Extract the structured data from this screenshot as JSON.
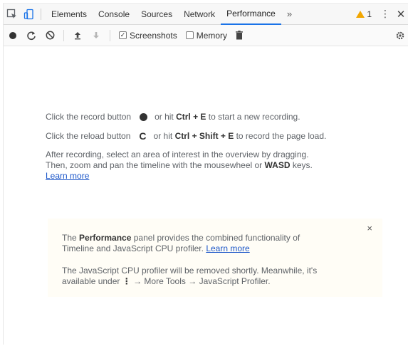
{
  "tabbar": {
    "tabs": [
      "Elements",
      "Console",
      "Sources",
      "Network",
      "Performance"
    ],
    "active_tab": "Performance",
    "more_label": "»",
    "warning_count": "1",
    "kebab_label": "⋮",
    "close_label": "✕"
  },
  "toolbar": {
    "screenshots_label": "Screenshots",
    "screenshots_checked": true,
    "memory_label": "Memory",
    "memory_checked": false
  },
  "landing": {
    "record_prefix": "Click the record button",
    "record_mid": "or hit",
    "record_keys": "Ctrl + E",
    "record_suffix": "to start a new recording.",
    "reload_prefix": "Click the reload button",
    "reload_mid": "or hit",
    "reload_keys": "Ctrl + Shift + E",
    "reload_suffix": "to record the page load.",
    "after_1": "After recording, select an area of interest in the overview by dragging.",
    "after_2": "Then, zoom and pan the timeline with the mousewheel or",
    "after_keys": "WASD",
    "after_3": "keys.",
    "learn_more": "Learn more"
  },
  "promo": {
    "close_label": "×",
    "p1_prefix": "The",
    "p1_bold": "Performance",
    "p1_mid": "panel provides the combined functionality of",
    "p1_line2": "Timeline and JavaScript CPU profiler.",
    "p1_link": "Learn more",
    "p2_line1": "The JavaScript CPU profiler will be removed shortly. Meanwhile, it's",
    "p2_prefix": "available under",
    "p2_kebab": "⋮",
    "p2_path": "→ More Tools → JavaScript Profiler."
  },
  "colors": {
    "active_tab_underline": "#1a73e8",
    "warning": "#f2a600",
    "link": "#1a55c8",
    "promo_background": "#fffdf6"
  }
}
